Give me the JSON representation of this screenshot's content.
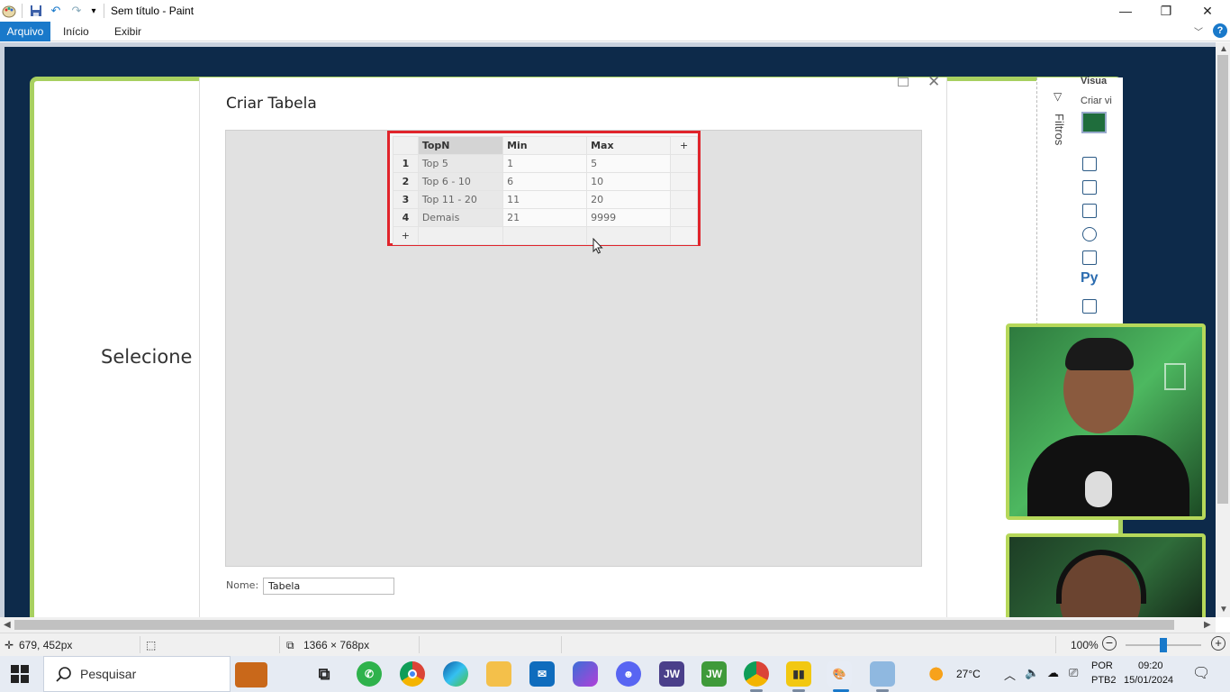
{
  "titlebar": {
    "title": "Sem título - Paint",
    "minimize": "—",
    "maximize": "❐",
    "close": "✕"
  },
  "ribbon": {
    "tabs": [
      {
        "label": "Arquivo"
      },
      {
        "label": "Início"
      },
      {
        "label": "Exibir"
      }
    ],
    "help": "?"
  },
  "dialog": {
    "title": "Criar Tabela",
    "table": {
      "headers": [
        "TopN",
        "Min",
        "Max",
        "+"
      ],
      "rows": [
        {
          "num": "1",
          "topn": "Top 5",
          "min": "1",
          "max": "5"
        },
        {
          "num": "2",
          "topn": "Top 6 - 10",
          "min": "6",
          "max": "10"
        },
        {
          "num": "3",
          "topn": "Top 11 - 20",
          "min": "11",
          "max": "20"
        },
        {
          "num": "4",
          "topn": "Demais",
          "min": "21",
          "max": "9999"
        }
      ],
      "add_row": "+"
    },
    "name_label": "Nome:",
    "name_value": "Tabela"
  },
  "canvas": {
    "left_text": "Selecione c",
    "filters_label": "Filtros",
    "visual_label": "Visua",
    "create_visual_label": "Criar vi"
  },
  "statusbar": {
    "cursor_pos": "679, 452px",
    "image_size": "1366 × 768px",
    "zoom": "100%"
  },
  "taskbar": {
    "search_placeholder": "Pesquisar",
    "weather": "27°C",
    "lang_top": "POR",
    "lang_bottom": "PTB2",
    "time": "09:20",
    "date": "15/01/2024",
    "apps": [
      "JW",
      "JW"
    ]
  },
  "colors": {
    "accent": "#1979ca",
    "highlight_border": "#e0242b",
    "slide_border": "#a8d060"
  }
}
